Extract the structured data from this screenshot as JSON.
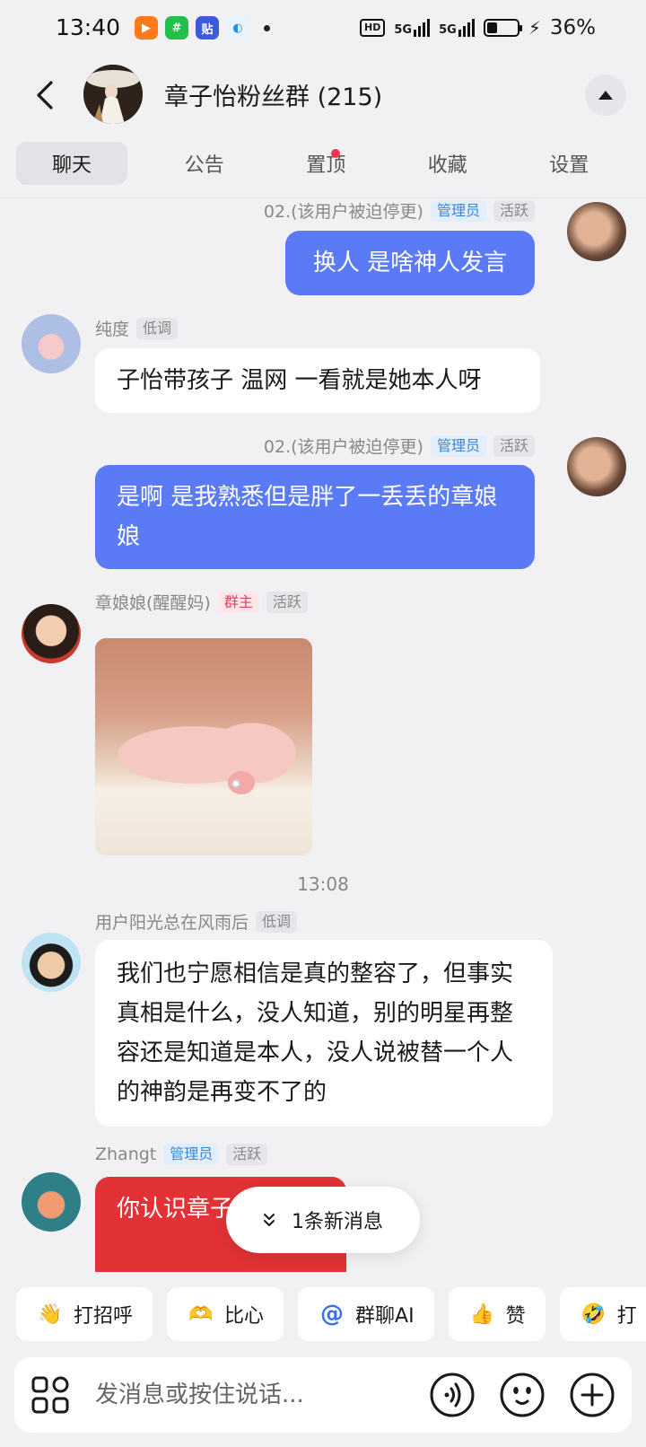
{
  "status_bar": {
    "time": "13:40",
    "apps": [
      {
        "name": "video-app-icon",
        "color": "#ff7a1a",
        "glyph": "▶"
      },
      {
        "name": "green-app-icon",
        "color": "#22c04a",
        "glyph": "#"
      },
      {
        "name": "tieba-app-icon",
        "color": "#3b5bdb",
        "glyph": "贴"
      },
      {
        "name": "browser-app-icon",
        "color": "#1f8ef1",
        "glyph": "◐"
      }
    ],
    "hd_label": "HD",
    "network_1": "5G",
    "network_2": "5G",
    "battery_percent": "36%",
    "battery_level": 0.36
  },
  "header": {
    "title": "章子怡粉丝群 (215)"
  },
  "tabs": [
    {
      "label": "聊天",
      "active": true
    },
    {
      "label": "公告"
    },
    {
      "label": "置顶",
      "has_dot": true
    },
    {
      "label": "收藏"
    },
    {
      "label": "设置"
    }
  ],
  "messages": {
    "m1": {
      "sender": "02.(该用户被迫停更)",
      "badges": [
        "管理员",
        "活跃"
      ],
      "text": "换人 是啥神人发言"
    },
    "m2": {
      "sender": "纯度",
      "badges": [
        "低调"
      ],
      "text": "子怡带孩子 温网 一看就是她本人呀"
    },
    "m3": {
      "sender": "02.(该用户被迫停更)",
      "badges": [
        "管理员",
        "活跃"
      ],
      "text": "是啊 是我熟悉但是胖了一丢丢的章娘娘"
    },
    "m4": {
      "sender": "章娘娘(醒醒妈)",
      "badges": [
        "群主",
        "活跃"
      ]
    },
    "time_divider": "13:08",
    "m5": {
      "sender": "用户阳光总在风雨后",
      "badges": [
        "低调"
      ],
      "text": "我们也宁愿相信是真的整容了，但事实真相是什么，没人知道，别的明星再整容还是知道是本人，没人说被替一个人的神韵是再变不了的"
    },
    "m6": {
      "sender": "Zhangt",
      "badges": [
        "管理员",
        "活跃"
      ],
      "text": "你认识章子怡啊?"
    }
  },
  "new_message_pill": "1条新消息",
  "quick_actions": [
    {
      "label": "打招呼",
      "icon": "wave-emoji-icon",
      "glyph": "👋"
    },
    {
      "label": "比心",
      "icon": "heart-hands-icon",
      "glyph": "🫶"
    },
    {
      "label": "群聊AI",
      "icon": "at-icon",
      "glyph": "@"
    },
    {
      "label": "赞",
      "icon": "thumbs-up-icon",
      "glyph": "👍"
    },
    {
      "label": "打",
      "icon": "laugh-emoji-icon",
      "glyph": "🤣"
    }
  ],
  "input": {
    "placeholder": "发消息或按住说话..."
  },
  "colors": {
    "outgoing_bubble": "#5b7bf6",
    "incoming_bubble": "#ffffff",
    "red_bubble": "#e23236",
    "tab_dot": "#f0344f"
  }
}
